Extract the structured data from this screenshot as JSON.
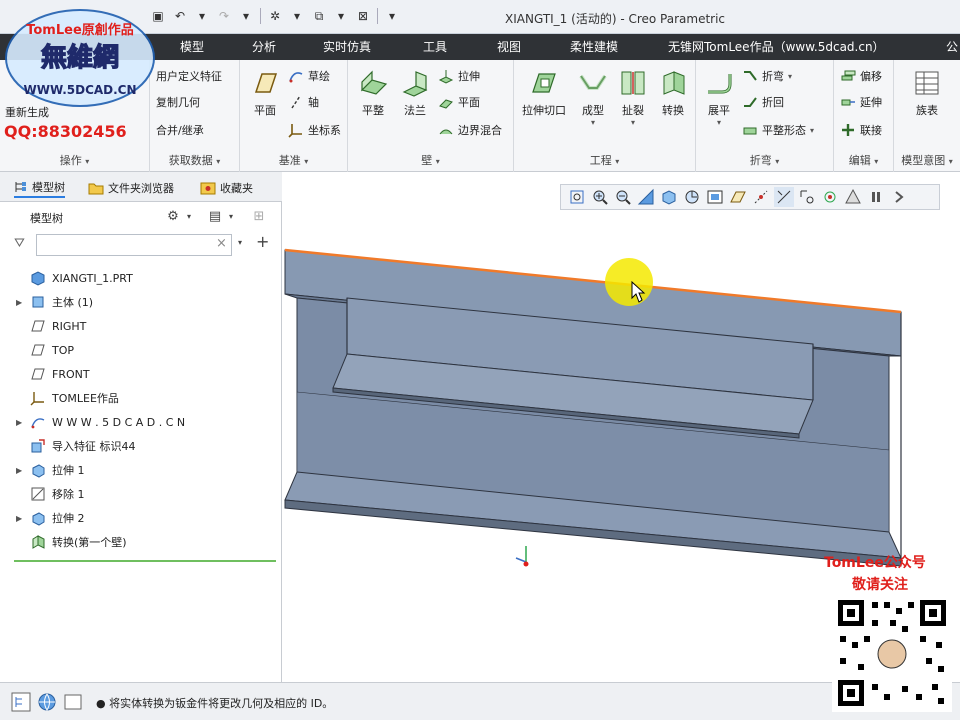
{
  "window": {
    "title": "XIANGTI_1 (活动的) - Creo Parametric"
  },
  "ribbon_tabs": [
    "模型",
    "分析",
    "实时仿真",
    "工具",
    "视图",
    "柔性建模",
    "无锥网TomLee作品（www.5dcad.cn）",
    "公"
  ],
  "ribbon": {
    "operations": {
      "regen_label": "重新生成",
      "group_label": "操作"
    },
    "get_data": {
      "items": [
        "用户定义特征",
        "复制几何",
        "合并/继承"
      ],
      "group_label": "获取数据"
    },
    "datum": {
      "plane_label": "平面",
      "items": [
        "草绘",
        "轴",
        "坐标系"
      ],
      "group_label": "基准"
    },
    "wall": {
      "big": [
        "平整",
        "法兰"
      ],
      "items": [
        "拉伸",
        "平面",
        "边界混合"
      ],
      "group_label": "壁"
    },
    "engineering": {
      "big": [
        "拉伸切口",
        "成型",
        "扯裂",
        "转换"
      ],
      "group_label": "工程"
    },
    "bend": {
      "big": [
        "展平"
      ],
      "items": [
        "折弯",
        "折回",
        "平整形态"
      ],
      "group_label": "折弯"
    },
    "edit": {
      "items": [
        "偏移",
        "延伸",
        "联接"
      ],
      "group_label": "编辑"
    },
    "model_intent": {
      "big": [
        "族表"
      ],
      "group_label": "模型意图"
    }
  },
  "nav_tabs": [
    "模型树",
    "文件夹浏览器",
    "收藏夹"
  ],
  "tree": {
    "header": "模型树",
    "filter_placeholder": "",
    "items": [
      {
        "label": "XIANGTI_1.PRT",
        "expand": ""
      },
      {
        "label": "主体 (1)",
        "expand": "▶"
      },
      {
        "label": "RIGHT",
        "expand": ""
      },
      {
        "label": "TOP",
        "expand": ""
      },
      {
        "label": "FRONT",
        "expand": ""
      },
      {
        "label": "TOMLEE作品",
        "expand": ""
      },
      {
        "label": "W W W . 5 D C A D . C N",
        "expand": "▶"
      },
      {
        "label": "导入特征 标识44",
        "expand": ""
      },
      {
        "label": "拉伸 1",
        "expand": "▶"
      },
      {
        "label": "移除 1",
        "expand": ""
      },
      {
        "label": "拉伸 2",
        "expand": "▶"
      },
      {
        "label": "转换(第一个壁)",
        "expand": ""
      }
    ]
  },
  "status": {
    "message": "● 将实体转换为钣金件将更改几何及相应的 ID。"
  },
  "watermark": {
    "logo_top": "TomLee原創作品",
    "logo_main": "無維網",
    "logo_url": "WWW.5DCAD.CN",
    "qq": "QQ:88302456",
    "gzh": "TomLee公众号",
    "follow": "敬请关注"
  },
  "colors": {
    "accent": "#2b7de1",
    "part": "#7c8da6",
    "highlight_edge": "#f07a2a",
    "watermark": "#e0201c"
  }
}
